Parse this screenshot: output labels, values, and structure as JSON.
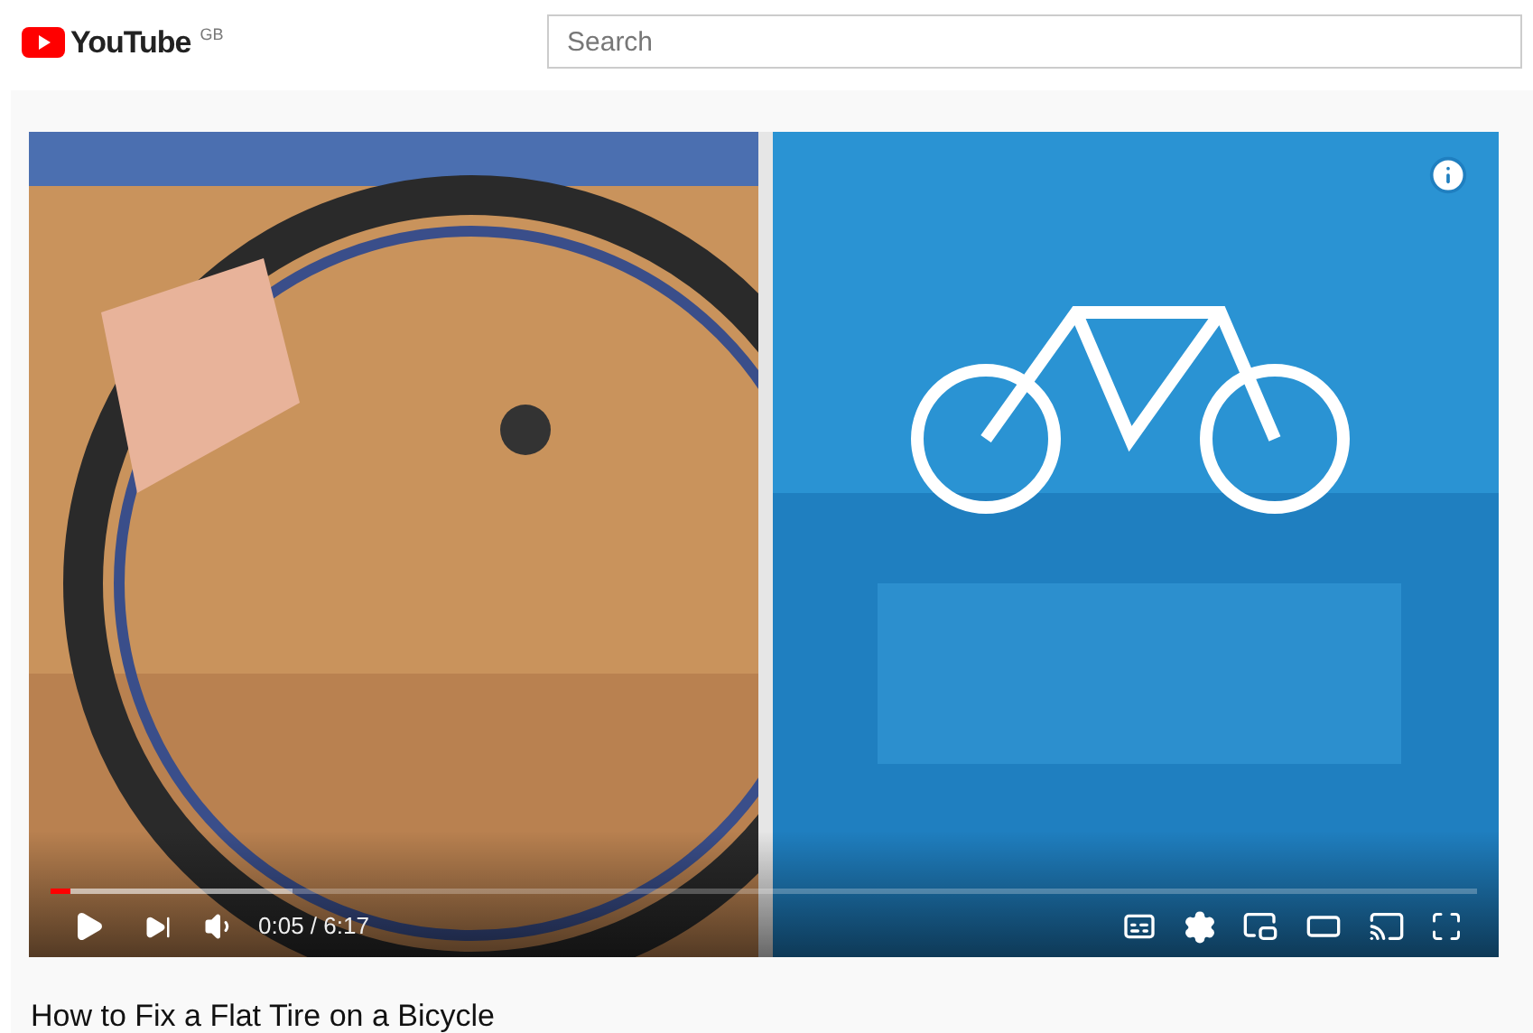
{
  "header": {
    "logo": "YouTube",
    "region": "GB",
    "search": {
      "placeholder": "Search"
    }
  },
  "player": {
    "time": "0:05 / 6:17",
    "progress": {
      "level": 0.014
    },
    "buffer": {
      "level": 0.17
    }
  },
  "video": {
    "title": "How to Fix a Flat Tire on a Bicycle"
  }
}
